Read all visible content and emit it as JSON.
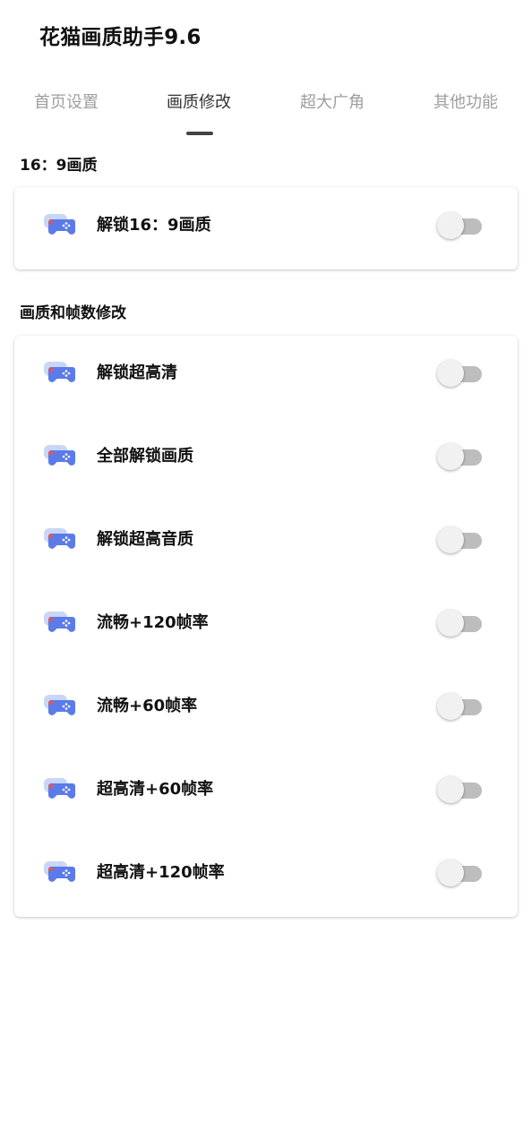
{
  "app": {
    "title": "花猫画质助手9.6"
  },
  "tabs": [
    {
      "label": "首页设置",
      "active": false
    },
    {
      "label": "画质修改",
      "active": true
    },
    {
      "label": "超大广角",
      "active": false
    },
    {
      "label": "其他功能",
      "active": false
    }
  ],
  "sections": [
    {
      "title": "16：9画质",
      "items": [
        {
          "label": "解锁16：9画质",
          "enabled": false,
          "icon": "gamepad-icon"
        }
      ]
    },
    {
      "title": "画质和帧数修改",
      "items": [
        {
          "label": "解锁超高清",
          "enabled": false,
          "icon": "gamepad-icon"
        },
        {
          "label": "全部解锁画质",
          "enabled": false,
          "icon": "gamepad-icon"
        },
        {
          "label": "解锁超高音质",
          "enabled": false,
          "icon": "gamepad-icon"
        },
        {
          "label": "流畅+120帧率",
          "enabled": false,
          "icon": "gamepad-icon"
        },
        {
          "label": "流畅+60帧率",
          "enabled": false,
          "icon": "gamepad-icon"
        },
        {
          "label": "超高清+60帧率",
          "enabled": false,
          "icon": "gamepad-icon"
        },
        {
          "label": "超高清+120帧率",
          "enabled": false,
          "icon": "gamepad-icon"
        }
      ]
    }
  ],
  "colors": {
    "icon_front": "#5b7be8",
    "icon_back": "#c9d6f6",
    "icon_cross": "#ef5350",
    "toggle_off_track": "#bdbdbd",
    "toggle_off_thumb": "#f1f1f1",
    "tab_active": "#333333",
    "tab_inactive": "#9e9e9e"
  }
}
